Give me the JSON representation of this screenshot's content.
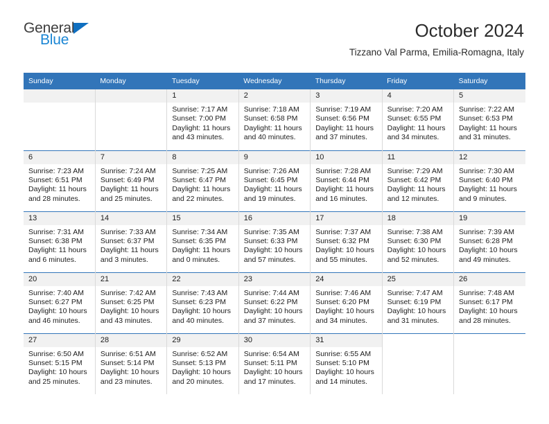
{
  "brand": {
    "name_top": "General",
    "name_bottom": "Blue",
    "accent_color": "#0f6fc0",
    "accent_color_light": "#1b86d4"
  },
  "header": {
    "title": "October 2024",
    "subtitle": "Tizzano Val Parma, Emilia-Romagna, Italy"
  },
  "calendar": {
    "header_bg": "#3275b9",
    "daynum_bg": "#f1f1f1",
    "weekday_headers": [
      "Sunday",
      "Monday",
      "Tuesday",
      "Wednesday",
      "Thursday",
      "Friday",
      "Saturday"
    ],
    "weeks": [
      [
        {
          "day": "",
          "sunrise": "",
          "sunset": "",
          "daylight": ""
        },
        {
          "day": "",
          "sunrise": "",
          "sunset": "",
          "daylight": ""
        },
        {
          "day": "1",
          "sunrise": "Sunrise: 7:17 AM",
          "sunset": "Sunset: 7:00 PM",
          "daylight": "Daylight: 11 hours and 43 minutes."
        },
        {
          "day": "2",
          "sunrise": "Sunrise: 7:18 AM",
          "sunset": "Sunset: 6:58 PM",
          "daylight": "Daylight: 11 hours and 40 minutes."
        },
        {
          "day": "3",
          "sunrise": "Sunrise: 7:19 AM",
          "sunset": "Sunset: 6:56 PM",
          "daylight": "Daylight: 11 hours and 37 minutes."
        },
        {
          "day": "4",
          "sunrise": "Sunrise: 7:20 AM",
          "sunset": "Sunset: 6:55 PM",
          "daylight": "Daylight: 11 hours and 34 minutes."
        },
        {
          "day": "5",
          "sunrise": "Sunrise: 7:22 AM",
          "sunset": "Sunset: 6:53 PM",
          "daylight": "Daylight: 11 hours and 31 minutes."
        }
      ],
      [
        {
          "day": "6",
          "sunrise": "Sunrise: 7:23 AM",
          "sunset": "Sunset: 6:51 PM",
          "daylight": "Daylight: 11 hours and 28 minutes."
        },
        {
          "day": "7",
          "sunrise": "Sunrise: 7:24 AM",
          "sunset": "Sunset: 6:49 PM",
          "daylight": "Daylight: 11 hours and 25 minutes."
        },
        {
          "day": "8",
          "sunrise": "Sunrise: 7:25 AM",
          "sunset": "Sunset: 6:47 PM",
          "daylight": "Daylight: 11 hours and 22 minutes."
        },
        {
          "day": "9",
          "sunrise": "Sunrise: 7:26 AM",
          "sunset": "Sunset: 6:45 PM",
          "daylight": "Daylight: 11 hours and 19 minutes."
        },
        {
          "day": "10",
          "sunrise": "Sunrise: 7:28 AM",
          "sunset": "Sunset: 6:44 PM",
          "daylight": "Daylight: 11 hours and 16 minutes."
        },
        {
          "day": "11",
          "sunrise": "Sunrise: 7:29 AM",
          "sunset": "Sunset: 6:42 PM",
          "daylight": "Daylight: 11 hours and 12 minutes."
        },
        {
          "day": "12",
          "sunrise": "Sunrise: 7:30 AM",
          "sunset": "Sunset: 6:40 PM",
          "daylight": "Daylight: 11 hours and 9 minutes."
        }
      ],
      [
        {
          "day": "13",
          "sunrise": "Sunrise: 7:31 AM",
          "sunset": "Sunset: 6:38 PM",
          "daylight": "Daylight: 11 hours and 6 minutes."
        },
        {
          "day": "14",
          "sunrise": "Sunrise: 7:33 AM",
          "sunset": "Sunset: 6:37 PM",
          "daylight": "Daylight: 11 hours and 3 minutes."
        },
        {
          "day": "15",
          "sunrise": "Sunrise: 7:34 AM",
          "sunset": "Sunset: 6:35 PM",
          "daylight": "Daylight: 11 hours and 0 minutes."
        },
        {
          "day": "16",
          "sunrise": "Sunrise: 7:35 AM",
          "sunset": "Sunset: 6:33 PM",
          "daylight": "Daylight: 10 hours and 57 minutes."
        },
        {
          "day": "17",
          "sunrise": "Sunrise: 7:37 AM",
          "sunset": "Sunset: 6:32 PM",
          "daylight": "Daylight: 10 hours and 55 minutes."
        },
        {
          "day": "18",
          "sunrise": "Sunrise: 7:38 AM",
          "sunset": "Sunset: 6:30 PM",
          "daylight": "Daylight: 10 hours and 52 minutes."
        },
        {
          "day": "19",
          "sunrise": "Sunrise: 7:39 AM",
          "sunset": "Sunset: 6:28 PM",
          "daylight": "Daylight: 10 hours and 49 minutes."
        }
      ],
      [
        {
          "day": "20",
          "sunrise": "Sunrise: 7:40 AM",
          "sunset": "Sunset: 6:27 PM",
          "daylight": "Daylight: 10 hours and 46 minutes."
        },
        {
          "day": "21",
          "sunrise": "Sunrise: 7:42 AM",
          "sunset": "Sunset: 6:25 PM",
          "daylight": "Daylight: 10 hours and 43 minutes."
        },
        {
          "day": "22",
          "sunrise": "Sunrise: 7:43 AM",
          "sunset": "Sunset: 6:23 PM",
          "daylight": "Daylight: 10 hours and 40 minutes."
        },
        {
          "day": "23",
          "sunrise": "Sunrise: 7:44 AM",
          "sunset": "Sunset: 6:22 PM",
          "daylight": "Daylight: 10 hours and 37 minutes."
        },
        {
          "day": "24",
          "sunrise": "Sunrise: 7:46 AM",
          "sunset": "Sunset: 6:20 PM",
          "daylight": "Daylight: 10 hours and 34 minutes."
        },
        {
          "day": "25",
          "sunrise": "Sunrise: 7:47 AM",
          "sunset": "Sunset: 6:19 PM",
          "daylight": "Daylight: 10 hours and 31 minutes."
        },
        {
          "day": "26",
          "sunrise": "Sunrise: 7:48 AM",
          "sunset": "Sunset: 6:17 PM",
          "daylight": "Daylight: 10 hours and 28 minutes."
        }
      ],
      [
        {
          "day": "27",
          "sunrise": "Sunrise: 6:50 AM",
          "sunset": "Sunset: 5:15 PM",
          "daylight": "Daylight: 10 hours and 25 minutes."
        },
        {
          "day": "28",
          "sunrise": "Sunrise: 6:51 AM",
          "sunset": "Sunset: 5:14 PM",
          "daylight": "Daylight: 10 hours and 23 minutes."
        },
        {
          "day": "29",
          "sunrise": "Sunrise: 6:52 AM",
          "sunset": "Sunset: 5:13 PM",
          "daylight": "Daylight: 10 hours and 20 minutes."
        },
        {
          "day": "30",
          "sunrise": "Sunrise: 6:54 AM",
          "sunset": "Sunset: 5:11 PM",
          "daylight": "Daylight: 10 hours and 17 minutes."
        },
        {
          "day": "31",
          "sunrise": "Sunrise: 6:55 AM",
          "sunset": "Sunset: 5:10 PM",
          "daylight": "Daylight: 10 hours and 14 minutes."
        },
        {
          "day": "",
          "sunrise": "",
          "sunset": "",
          "daylight": ""
        },
        {
          "day": "",
          "sunrise": "",
          "sunset": "",
          "daylight": ""
        }
      ]
    ]
  }
}
